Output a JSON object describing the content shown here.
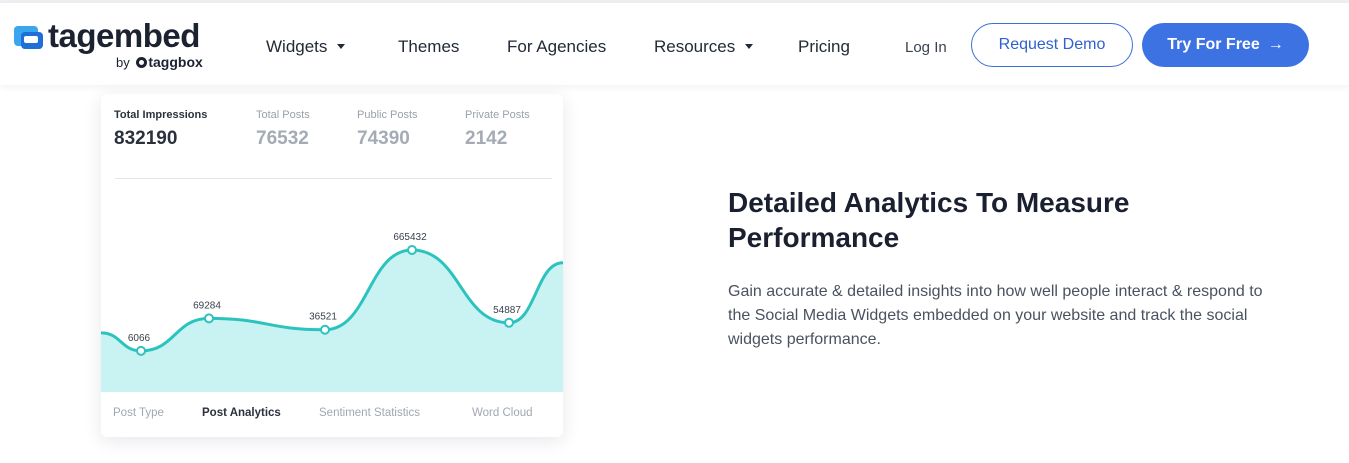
{
  "brand": {
    "name": "tagembed",
    "by_prefix": "by",
    "by_brand": "taggbox",
    "accent_color": "#3d72e3",
    "mark_color": "#3aa6ef"
  },
  "nav": {
    "items": [
      {
        "label": "Widgets",
        "has_dropdown": true
      },
      {
        "label": "Themes",
        "has_dropdown": false
      },
      {
        "label": "For Agencies",
        "has_dropdown": false
      },
      {
        "label": "Resources",
        "has_dropdown": true
      },
      {
        "label": "Pricing",
        "has_dropdown": false
      }
    ],
    "login": "Log In",
    "request_demo": "Request Demo",
    "try_free": "Try For Free",
    "try_free_arrow": "→"
  },
  "analytics": {
    "stats": [
      {
        "label": "Total Impressions",
        "value": "832190",
        "active": true
      },
      {
        "label": "Total Posts",
        "value": "76532",
        "active": false
      },
      {
        "label": "Public Posts",
        "value": "74390",
        "active": false
      },
      {
        "label": "Private Posts",
        "value": "2142",
        "active": false
      }
    ],
    "tabs": [
      {
        "label": "Post Type",
        "active": false
      },
      {
        "label": "Post Analytics",
        "active": true
      },
      {
        "label": "Sentiment Statistics",
        "active": false
      },
      {
        "label": "Word Cloud",
        "active": false
      }
    ]
  },
  "chart_data": {
    "type": "area",
    "title": "",
    "xlabel": "",
    "ylabel": "",
    "points": [
      {
        "label": "6066",
        "value": 6066
      },
      {
        "label": "69284",
        "value": 69284
      },
      {
        "label": "36521",
        "value": 36521
      },
      {
        "label": "665432",
        "value": 665432
      },
      {
        "label": "54887",
        "value": 54887
      }
    ],
    "line_color": "#2cc3be",
    "fill_color": "#c9f3f2"
  },
  "content": {
    "headline": "Detailed Analytics To Measure Performance",
    "description": "Gain accurate & detailed insights into how well people interact & respond to the Social Media Widgets embedded on your website and track the social widgets performance."
  }
}
